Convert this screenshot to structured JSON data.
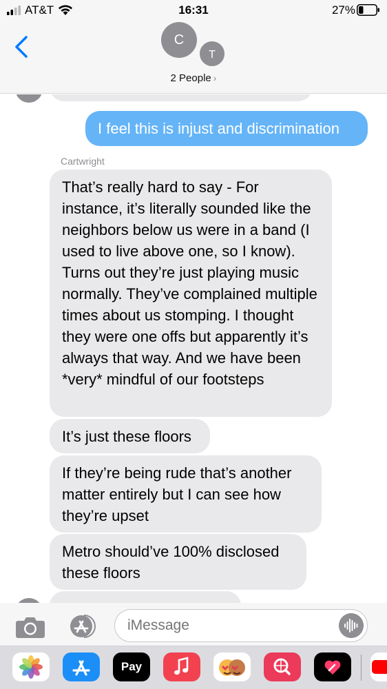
{
  "status_bar": {
    "carrier": "AT&T",
    "time": "16:31",
    "battery_percent": "27%",
    "battery_level": 0.27
  },
  "header": {
    "avatars": [
      "C",
      "T"
    ],
    "people_label": "2 People",
    "people_chevron": "›"
  },
  "messages": [
    {
      "type": "outgoing",
      "text": "I feel this is injust and discrimination"
    },
    {
      "type": "sender",
      "text": "Cartwright"
    },
    {
      "type": "incoming",
      "text": "That’s really hard to say - For instance, it’s literally sounded like the neighbors below us were in a band (I used to live above one, so I know). Turns out they’re just playing music normally. They’ve complained multiple times about us stomping. I thought they were one offs but apparently it’s always that way. And we have been *very* mindful of our footsteps"
    },
    {
      "type": "incoming",
      "text": "It’s just these floors"
    },
    {
      "type": "incoming",
      "text": "If they’re being rude that’s another matter entirely but I can see how they’re upset"
    },
    {
      "type": "incoming",
      "text": "Metro should’ve 100% disclosed these floors"
    }
  ],
  "input": {
    "placeholder": "iMessage"
  },
  "app_drawer": {
    "items": [
      "photos-icon",
      "app-store-icon",
      "apple-pay-icon",
      "music-icon",
      "memoji-icon",
      "web-search-icon",
      "digital-touch-icon",
      "youtube-icon"
    ],
    "apple_pay_label": "Pay"
  },
  "colors": {
    "outgoing_bubble": "#65b4f7",
    "incoming_bubble": "#e9e9eb",
    "accent": "#007aff"
  }
}
